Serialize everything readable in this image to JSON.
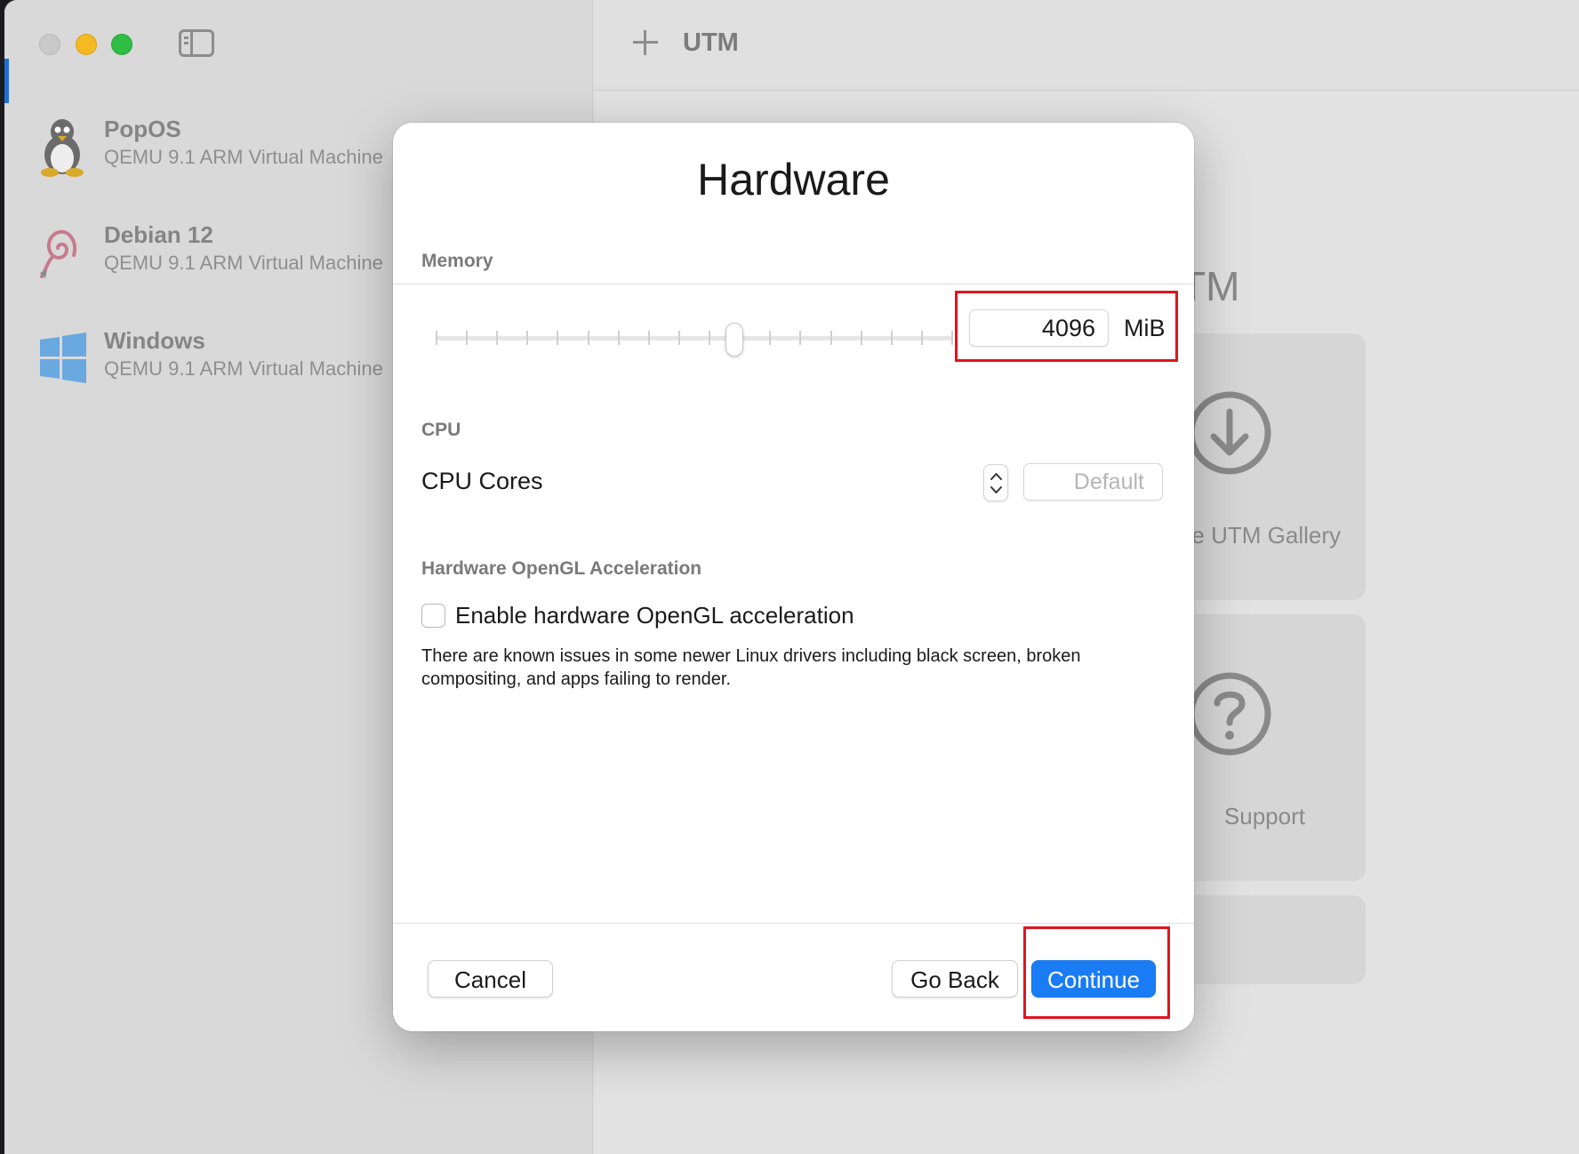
{
  "window": {
    "toolbar_title": "UTM"
  },
  "sidebar": {
    "items": [
      {
        "name": "PopOS",
        "description": "QEMU 9.1 ARM Virtual Machine",
        "icon": "linux-penguin-icon"
      },
      {
        "name": "Debian 12",
        "description": "QEMU 9.1 ARM Virtual Machine",
        "icon": "debian-swirl-icon"
      },
      {
        "name": "Windows",
        "description": "QEMU 9.1 ARM Virtual Machine",
        "icon": "windows-logo-icon"
      }
    ]
  },
  "welcome": {
    "title_fragment": "TM",
    "cards": [
      {
        "label": "e UTM Gallery",
        "icon": "download-circle-icon"
      },
      {
        "label": "Support",
        "icon": "question-circle-icon"
      }
    ]
  },
  "dialog": {
    "title": "Hardware",
    "memory": {
      "section_label": "Memory",
      "value": "4096",
      "unit": "MiB",
      "slider_position": 0.58
    },
    "cpu": {
      "section_label": "CPU",
      "cores_label": "CPU Cores",
      "cores_placeholder": "Default"
    },
    "opengl": {
      "section_label": "Hardware OpenGL Acceleration",
      "checkbox_label": "Enable hardware OpenGL acceleration",
      "checked": false,
      "help_text": "There are known issues in some newer Linux drivers including black screen, broken compositing, and apps failing to render."
    },
    "buttons": {
      "cancel": "Cancel",
      "go_back": "Go Back",
      "continue": "Continue"
    }
  },
  "colors": {
    "accent": "#1a7cf5",
    "highlight": "#e0141e",
    "traffic_close": "#c9c9c9",
    "traffic_minimize": "#f5b922",
    "traffic_maximize": "#2fbd44"
  }
}
